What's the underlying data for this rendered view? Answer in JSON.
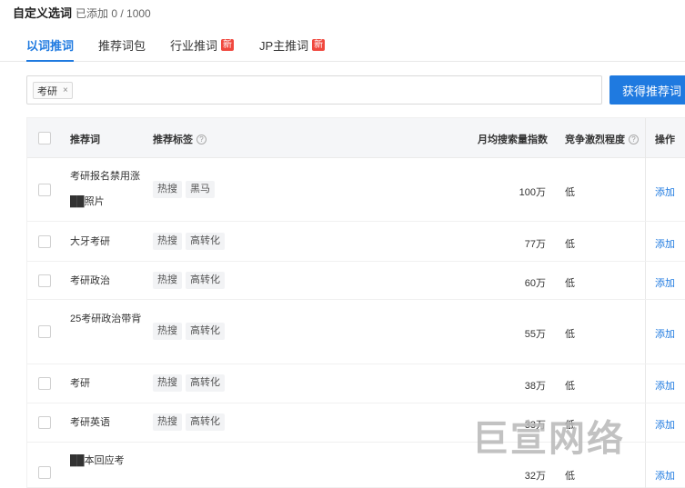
{
  "header": {
    "title": "自定义选词",
    "count": "已添加 0 / 1000"
  },
  "tabs": [
    {
      "label": "以词推词",
      "active": true,
      "badge": ""
    },
    {
      "label": "推荐词包",
      "active": false,
      "badge": ""
    },
    {
      "label": "行业推词",
      "active": false,
      "badge": "新"
    },
    {
      "label": "JP主推词",
      "active": false,
      "badge": "新"
    }
  ],
  "search": {
    "chip": "考研",
    "chip_remove": "×",
    "button": "获得推荐词"
  },
  "table": {
    "headers": {
      "keyword": "推荐词",
      "tags": "推荐标签",
      "volume": "月均搜索量指数",
      "competition": "竞争激烈程度",
      "operation": "操作",
      "help_icon": "?"
    },
    "rows": [
      {
        "keyword": "考研报名禁用涨██照片",
        "tags": [
          "热搜",
          "黑马"
        ],
        "volume": "100万",
        "competition": "低",
        "action": "添加"
      },
      {
        "keyword": "大牙考研",
        "tags": [
          "热搜",
          "高转化"
        ],
        "volume": "77万",
        "competition": "低",
        "action": "添加"
      },
      {
        "keyword": "考研政治",
        "tags": [
          "热搜",
          "高转化"
        ],
        "volume": "60万",
        "competition": "低",
        "action": "添加"
      },
      {
        "keyword": "25考研政治带背",
        "tags": [
          "热搜",
          "高转化"
        ],
        "volume": "55万",
        "competition": "低",
        "action": "添加"
      },
      {
        "keyword": "考研",
        "tags": [
          "热搜",
          "高转化"
        ],
        "volume": "38万",
        "competition": "低",
        "action": "添加"
      },
      {
        "keyword": "考研英语",
        "tags": [
          "热搜",
          "高转化"
        ],
        "volume": "33万",
        "competition": "低",
        "action": "添加"
      },
      {
        "keyword": "██本回应考",
        "tags": [],
        "volume": "32万",
        "competition": "低",
        "action": "添加"
      }
    ]
  },
  "watermark": "巨宣网络"
}
